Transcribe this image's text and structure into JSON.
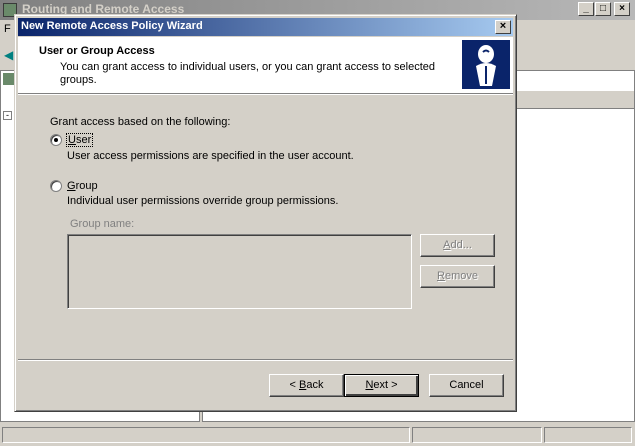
{
  "background_app": {
    "title": "Routing and Remote Access",
    "menu_first_letter": "F",
    "controls": {
      "minimize": "_",
      "maximize": "□",
      "close": "×"
    }
  },
  "wizard": {
    "title": "New Remote Access Policy Wizard",
    "close_glyph": "×",
    "header": {
      "title": "User or Group Access",
      "description": "You can grant access to individual users, or you can grant access to selected groups."
    },
    "grant_label": "Grant access based on the following:",
    "options": [
      {
        "name": "user",
        "label_mnemonic": "U",
        "label_rest": "ser",
        "description": "User access permissions are specified in the user account.",
        "selected": true
      },
      {
        "name": "group",
        "label_mnemonic": "G",
        "label_rest": "roup",
        "description": "Individual user permissions override group permissions.",
        "selected": false
      }
    ],
    "group_name_label": "Group name:",
    "buttons": {
      "add": {
        "mnemonic": "A",
        "rest": "dd..."
      },
      "remove": {
        "mnemonic": "R",
        "rest": "emove"
      },
      "back_prefix": "< ",
      "back_mnemonic": "B",
      "back_rest": "ack",
      "next_mnemonic": "N",
      "next_rest": "ext >",
      "cancel": "Cancel"
    }
  },
  "colors": {
    "title_active_start": "#0a246a",
    "title_active_end": "#a6caf0",
    "face": "#d4d0c8"
  }
}
